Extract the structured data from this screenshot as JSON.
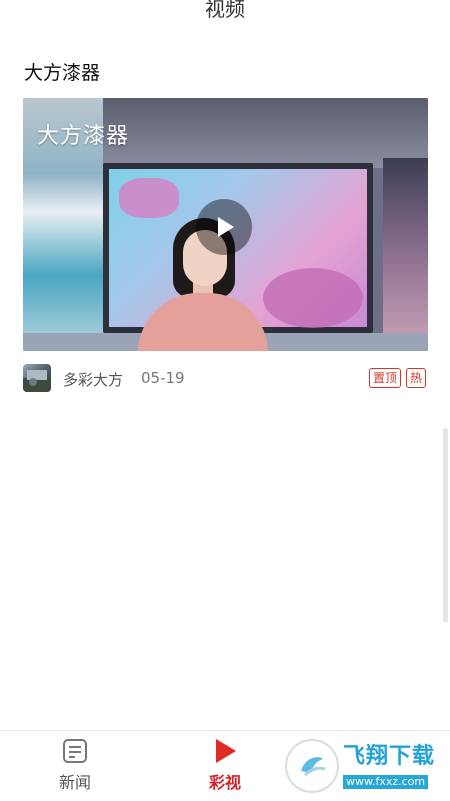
{
  "header": {
    "title": "视频"
  },
  "feed": {
    "items": [
      {
        "title": "大方漆器",
        "thumbnail_overlay_text": "大方漆器",
        "source": "多彩大方",
        "date": "05-19",
        "badges": {
          "pinned": "置顶",
          "hot": "热"
        }
      }
    ]
  },
  "bottom_nav": {
    "items": [
      {
        "label": "新闻",
        "icon": "news-icon",
        "active": false
      },
      {
        "label": "彩视",
        "icon": "play-icon",
        "active": true
      }
    ]
  },
  "watermark": {
    "text": "飞翔下载",
    "url": "www.fxxz.com"
  },
  "colors": {
    "accent": "#d4262a",
    "badge": "#d4372a",
    "watermark": "#22a2d8"
  }
}
